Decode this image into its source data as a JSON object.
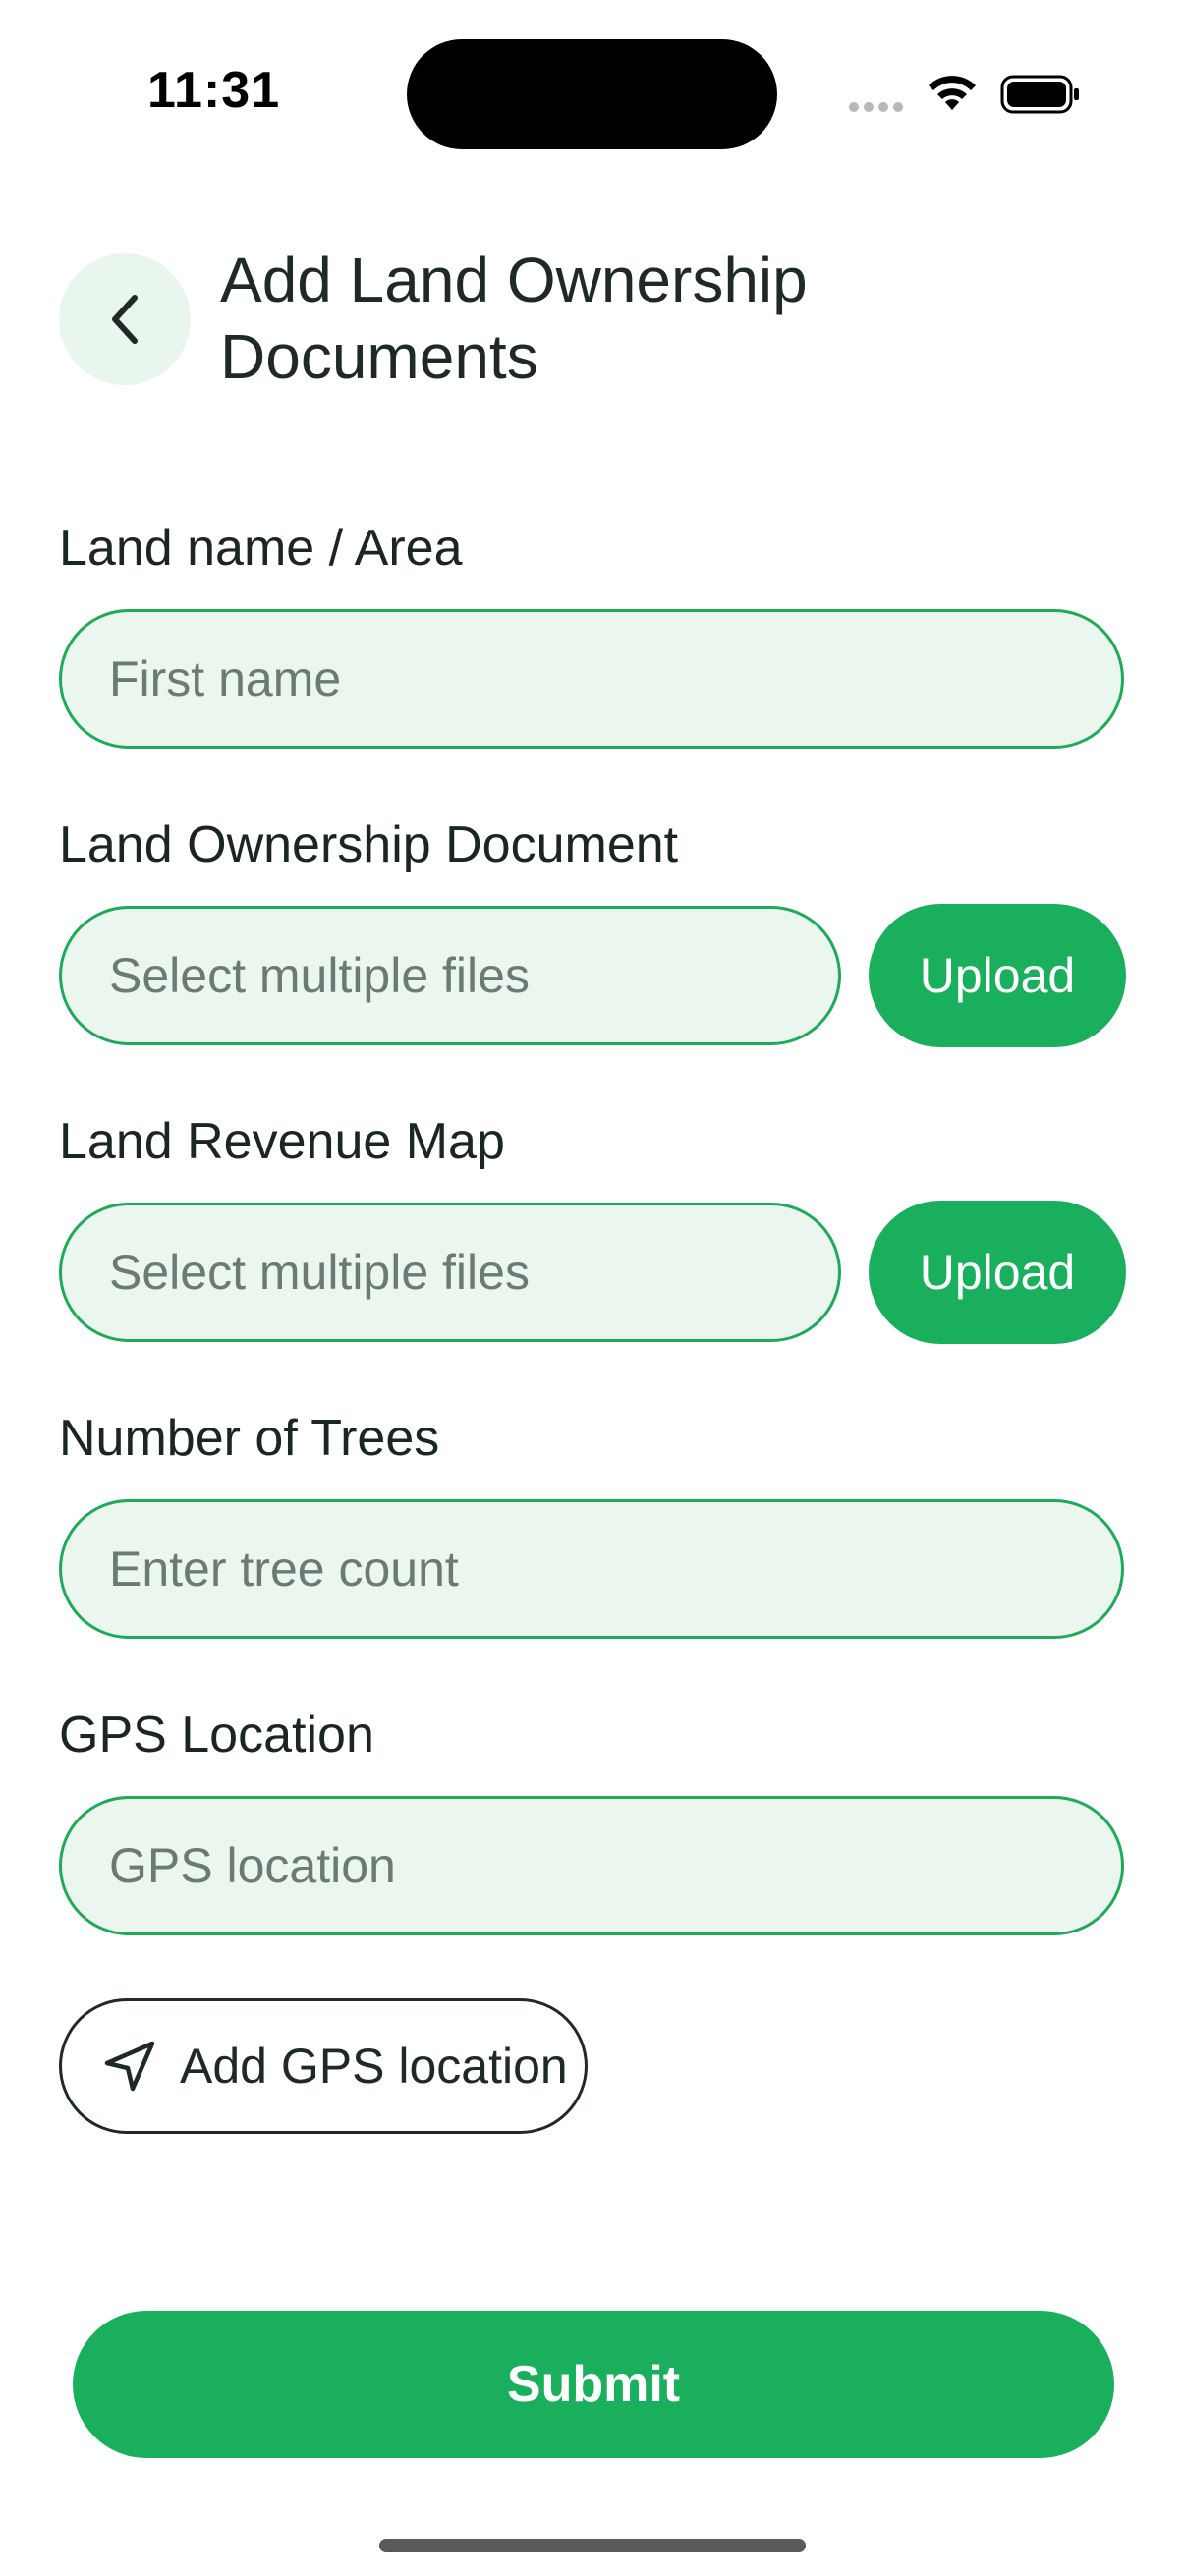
{
  "status_bar": {
    "time": "11:31"
  },
  "header": {
    "title": "Add Land Ownership Documents",
    "back_icon": "chevron-left-icon"
  },
  "form": {
    "land_name": {
      "label": "Land name / Area",
      "placeholder": "First name",
      "value": ""
    },
    "ownership_document": {
      "label": "Land Ownership Document",
      "placeholder": "Select multiple files",
      "value": "",
      "upload_label": "Upload"
    },
    "revenue_map": {
      "label": "Land Revenue Map",
      "placeholder": "Select multiple files",
      "value": "",
      "upload_label": "Upload"
    },
    "trees": {
      "label": "Number of Trees",
      "placeholder": "Enter tree count",
      "value": ""
    },
    "gps": {
      "label": "GPS Location",
      "placeholder": "GPS location",
      "value": "",
      "add_label": "Add GPS location",
      "add_icon": "navigation-arrow-icon"
    }
  },
  "submit_label": "Submit",
  "colors": {
    "accent": "#1aaf5d",
    "field_bg": "#eaf6ee",
    "field_border": "#1faa5b",
    "text": "#1f2a24"
  }
}
